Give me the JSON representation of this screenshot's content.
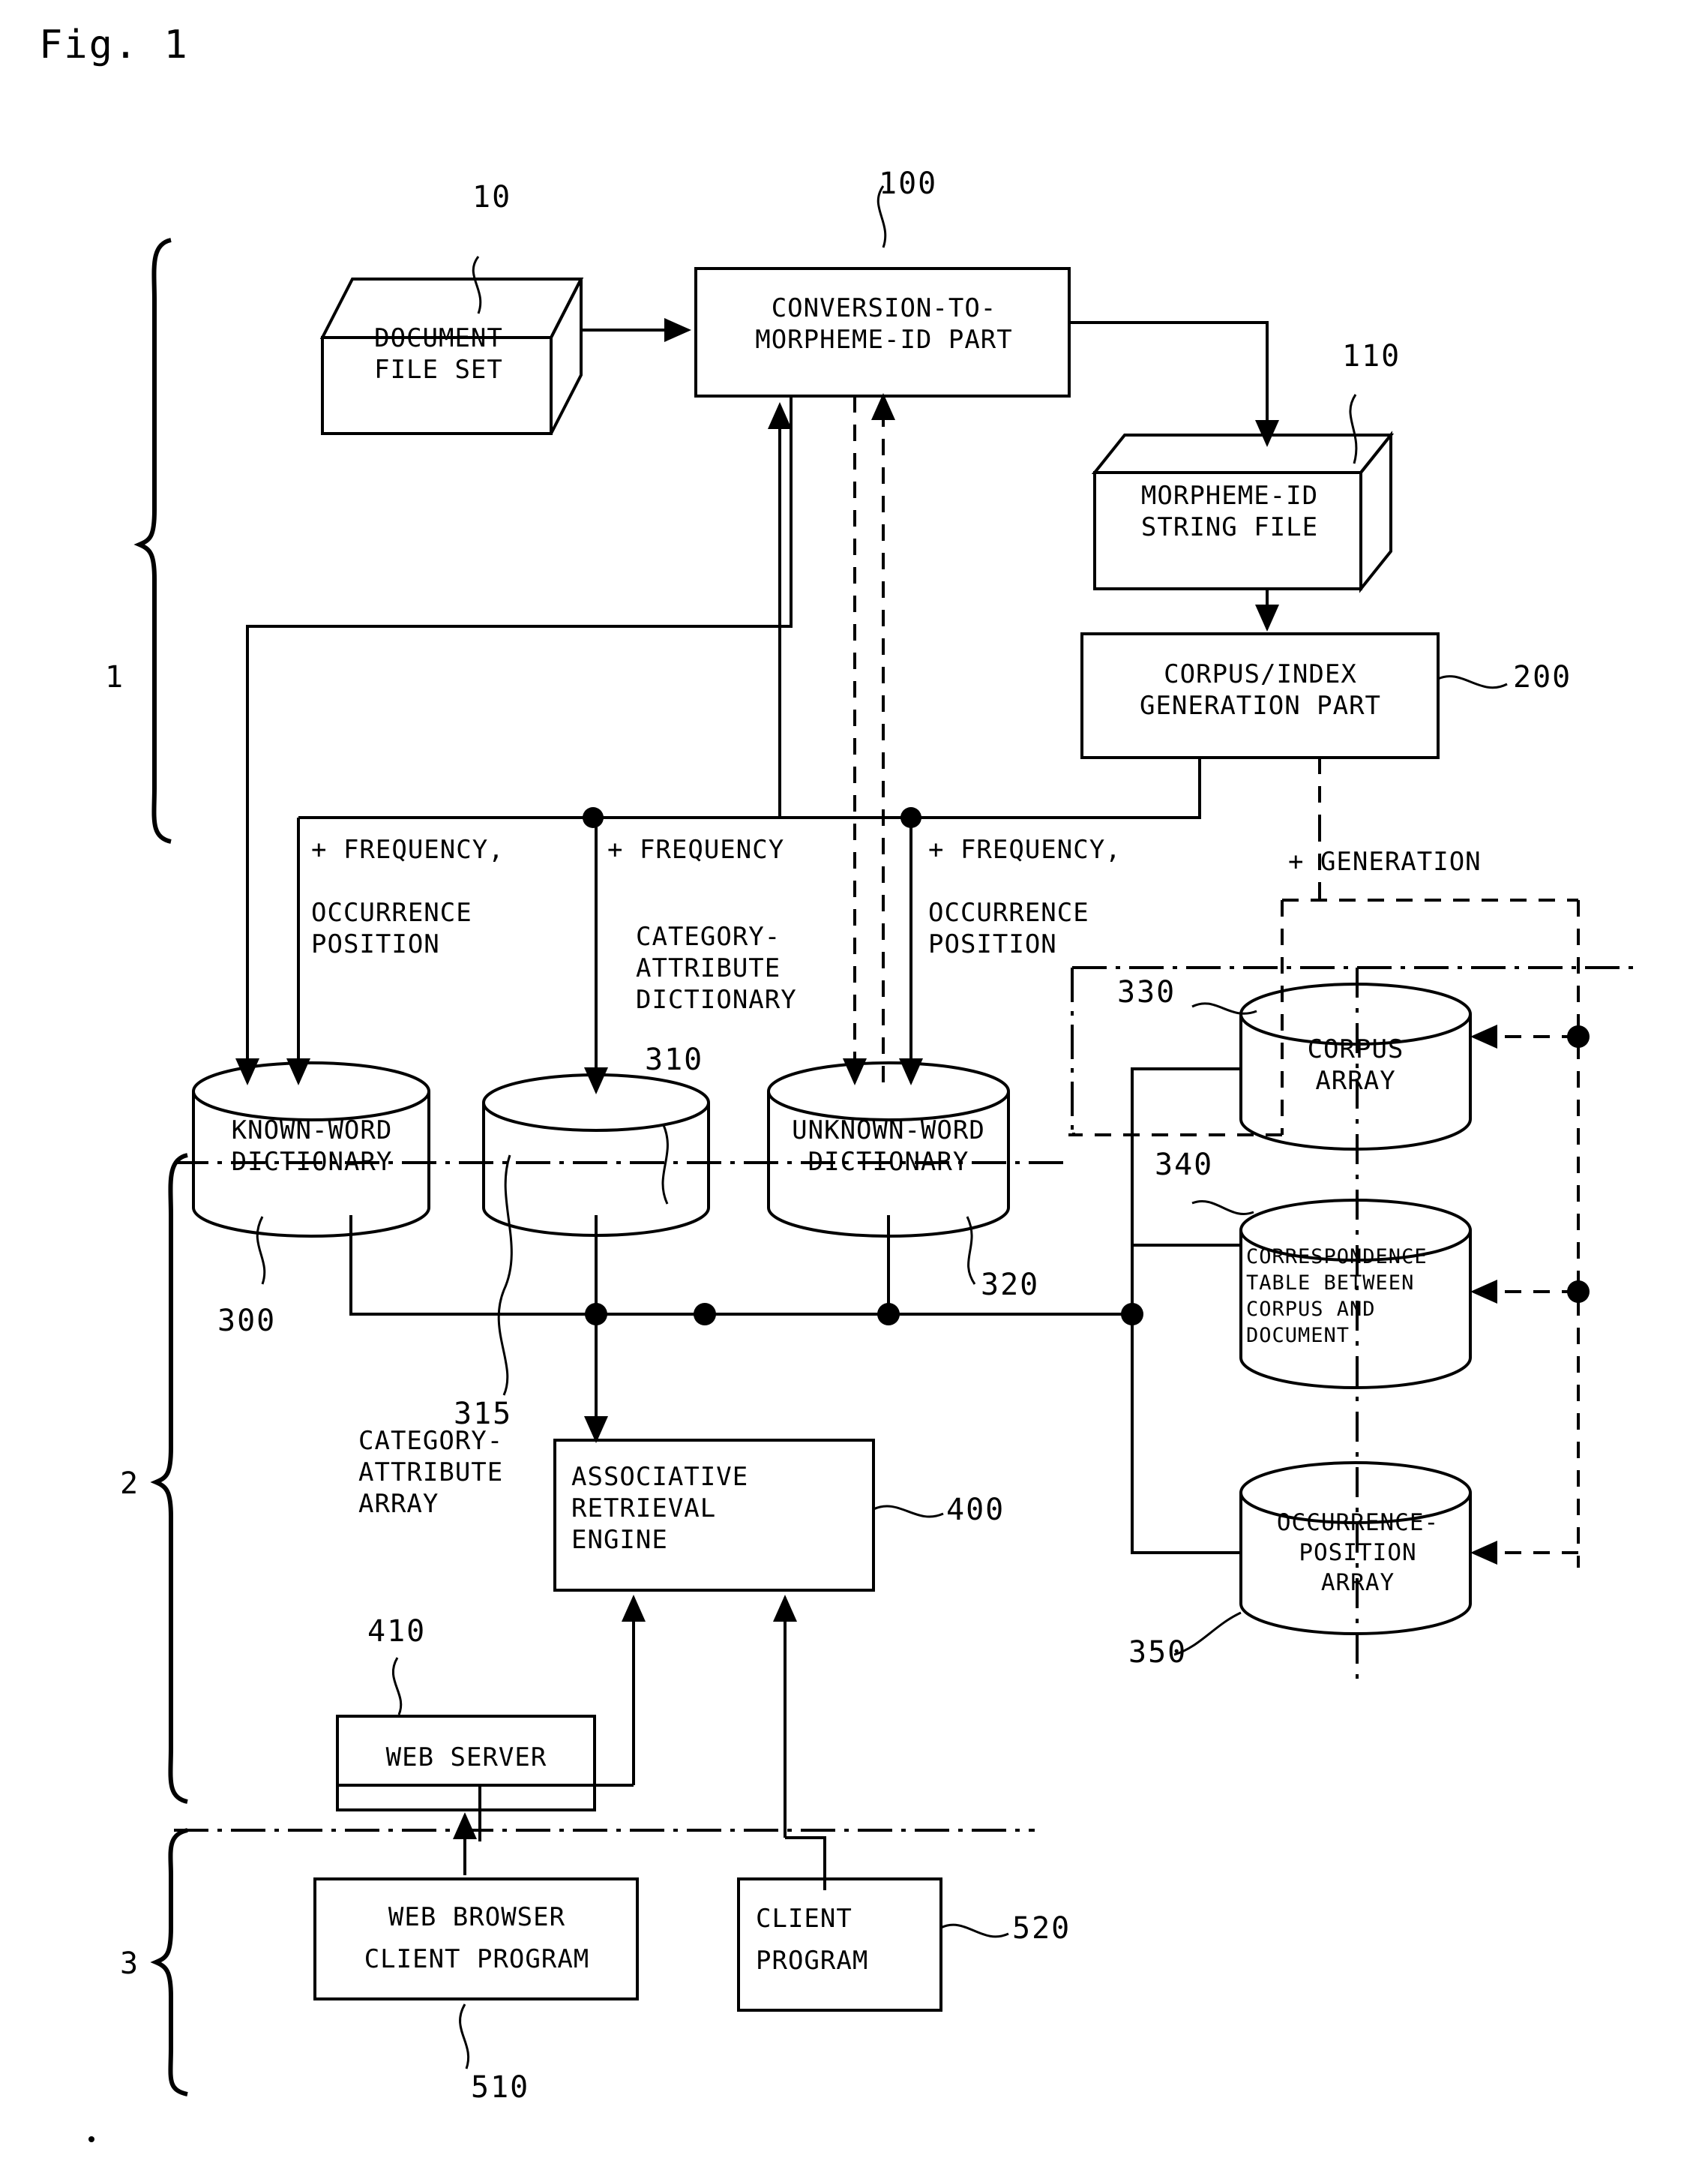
{
  "figure": {
    "title": "Fig. 1"
  },
  "groups": [
    {
      "id": "group-1",
      "label": "1"
    },
    {
      "id": "group-2",
      "label": "2"
    },
    {
      "id": "group-3",
      "label": "3"
    }
  ],
  "nodes": {
    "document_file_set": {
      "label": "DOCUMENT\nFILE SET",
      "ref": "10",
      "shape": "3d-box"
    },
    "conversion_part": {
      "label": "CONVERSION-TO-\nMORPHEME-ID PART",
      "ref": "100",
      "shape": "rect"
    },
    "morpheme_id_string_file": {
      "label": "MORPHEME-ID\nSTRING FILE",
      "ref": "110",
      "shape": "3d-box"
    },
    "corpus_index_generation_part": {
      "label": "CORPUS/INDEX\nGENERATION PART",
      "ref": "200",
      "shape": "rect"
    },
    "known_word_dictionary": {
      "label": "KNOWN-WORD\nDICTIONARY",
      "ref": "300",
      "shape": "cylinder"
    },
    "category_attribute_dictionary": {
      "label": "",
      "ref": "310",
      "ref2": "315",
      "shape": "cylinder"
    },
    "unknown_word_dictionary": {
      "label": "UNKNOWN-WORD\nDICTIONARY",
      "ref": "320",
      "shape": "cylinder"
    },
    "corpus_array": {
      "label": "CORPUS\nARRAY",
      "ref": "330",
      "shape": "cylinder"
    },
    "correspondence_table": {
      "label": "CORRESPONDENCE\nTABLE BETWEEN\nCORPUS AND\nDOCUMENT",
      "ref": "340",
      "shape": "cylinder"
    },
    "occurrence_position_array": {
      "label": "OCCURRENCE-\nPOSITION\nARRAY",
      "ref": "350",
      "shape": "cylinder"
    },
    "associative_retrieval_engine": {
      "label": "ASSOCIATIVE\nRETRIEVAL\nENGINE",
      "ref": "400",
      "shape": "rect"
    },
    "web_server": {
      "label": "WEB SERVER",
      "ref": "410",
      "shape": "rect"
    },
    "web_browser_client_program": {
      "label": "WEB BROWSER\nCLIENT PROGRAM",
      "ref": "510",
      "shape": "rect"
    },
    "client_program": {
      "label": "CLIENT\nPROGRAM",
      "ref": "520",
      "shape": "rect"
    }
  },
  "annotations": {
    "freq_occurrence_left": "+ FREQUENCY,\n\nOCCURRENCE\nPOSITION",
    "freq_middle": "+ FREQUENCY",
    "category_attribute_dictionary_caption": "CATEGORY-\nATTRIBUTE\nDICTIONARY",
    "freq_occurrence_right": "+ FREQUENCY,\n\nOCCURRENCE\nPOSITION",
    "generation": "+ GENERATION",
    "category_attribute_array_caption": "CATEGORY-\nATTRIBUTE\nARRAY"
  },
  "refs": {
    "r10": "10",
    "r100": "100",
    "r110": "110",
    "r200": "200",
    "r300": "300",
    "r310": "310",
    "r315": "315",
    "r320": "320",
    "r330": "330",
    "r340": "340",
    "r350": "350",
    "r400": "400",
    "r410": "410",
    "r510": "510",
    "r520": "520"
  },
  "colors": {
    "ink": "#000000",
    "paper": "#ffffff"
  }
}
